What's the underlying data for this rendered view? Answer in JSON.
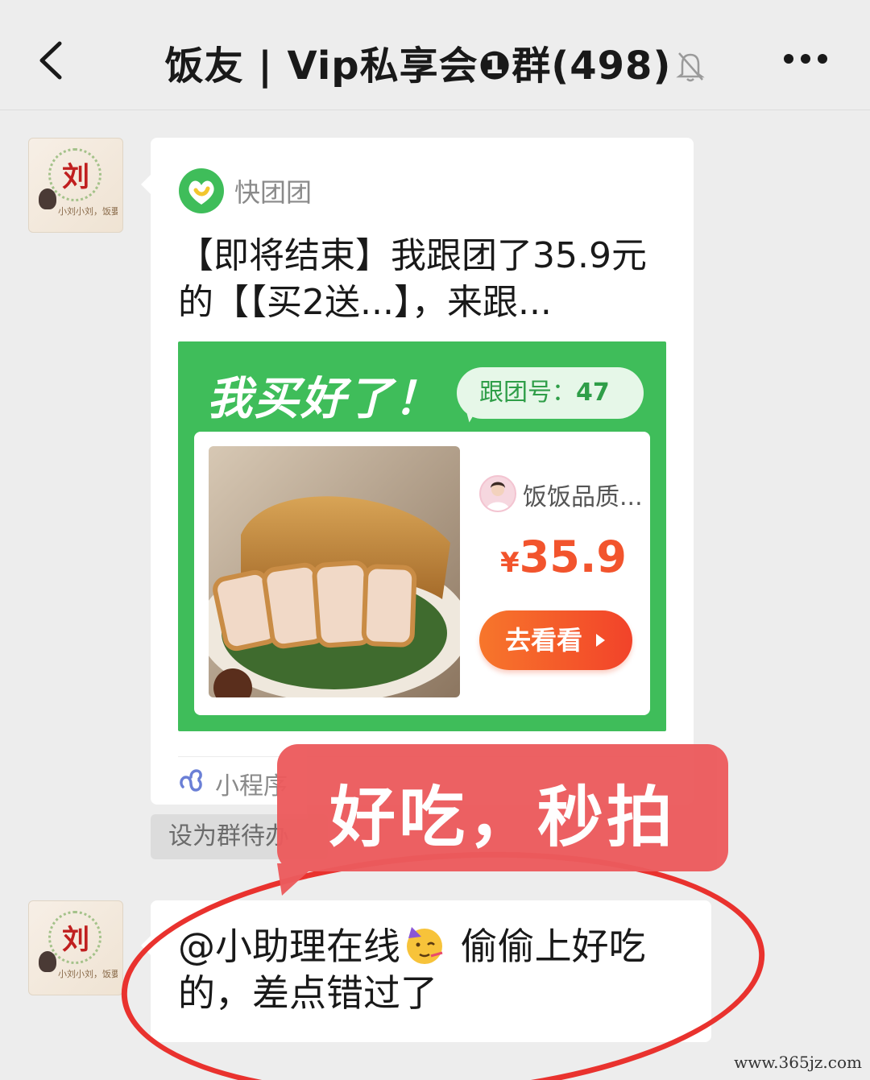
{
  "header": {
    "title": "饭友 | Vip私享会❶群(498)"
  },
  "messages": {
    "card": {
      "app_name": "快团团",
      "title": "【即将结束】我跟团了35.9元的【【买2送...】，来跟...",
      "promo_headline": "我买好了！",
      "group_label": "跟团号：",
      "group_number": "47",
      "seller_name": "饭饭品质...",
      "price_currency": "¥",
      "price_value": "35.9",
      "view_button_label": "去看看",
      "footer_label": "小程序"
    },
    "set_todo_label": "设为群待办",
    "text_message": {
      "mention": "@小助理在线",
      "body_after_emoji": " 偷偷上好吃的，差点错过了"
    }
  },
  "overlay": {
    "annotation_text": "好吃，秒拍",
    "annotation_color": "#ec5b5d",
    "circle_color": "#e9322e"
  },
  "avatar": {
    "char": "刘",
    "caption": "小刘小刘，饭要一起"
  },
  "watermark": "www.365jz.com",
  "colors": {
    "app_green": "#3fbd5a",
    "price_red": "#f2542d",
    "button_orange": "#f7762b"
  },
  "icons": [
    "back-icon",
    "mute-icon",
    "more-icon",
    "app-logo-icon",
    "play-icon",
    "mini-program-icon",
    "party-face-icon"
  ]
}
